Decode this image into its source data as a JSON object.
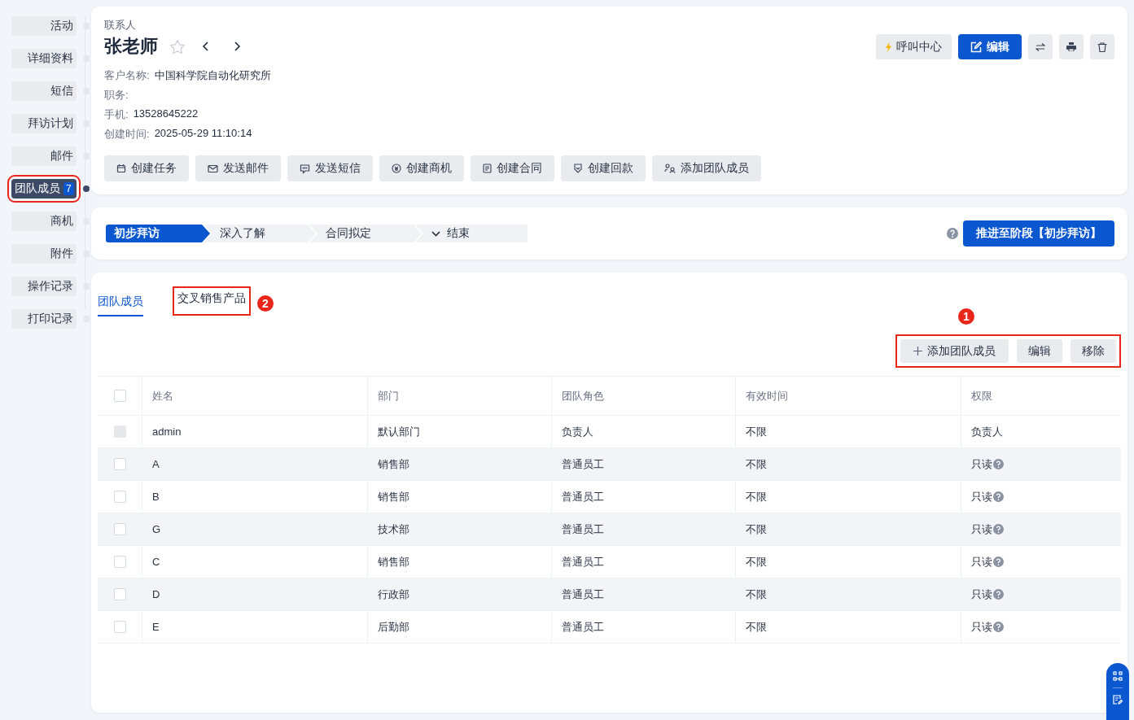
{
  "sidebar": {
    "items": [
      {
        "label": "活动",
        "selected": false
      },
      {
        "label": "详细资料",
        "selected": false
      },
      {
        "label": "短信",
        "selected": false
      },
      {
        "label": "拜访计划",
        "selected": false
      },
      {
        "label": "邮件",
        "selected": false
      },
      {
        "label": "团队成员",
        "count": "7",
        "selected": true,
        "highlighted": true
      },
      {
        "label": "商机",
        "selected": false
      },
      {
        "label": "附件",
        "selected": false
      },
      {
        "label": "操作记录",
        "selected": false
      },
      {
        "label": "打印记录",
        "selected": false
      }
    ]
  },
  "contact": {
    "type_label": "联系人",
    "name": "张老师",
    "starred": false,
    "fields": [
      {
        "label": "客户名称:",
        "value": "中国科学院自动化研究所"
      },
      {
        "label": "职务:"
      },
      {
        "label": "手机:",
        "value": "13528645222"
      },
      {
        "label": "创建时间:",
        "value": "2025-05-29 11:10:14"
      }
    ],
    "call_button": "呼叫中心",
    "edit_button": "编辑",
    "actions": [
      "创建任务",
      "发送邮件",
      "发送短信",
      "创建商机",
      "创建合同",
      "创建回款",
      "添加团队成员"
    ]
  },
  "stages": {
    "items": [
      {
        "label": "初步拜访",
        "selected": true
      },
      {
        "label": "深入了解",
        "selected": false
      },
      {
        "label": "合同拟定",
        "selected": false
      },
      {
        "label": "结束",
        "selected": false,
        "kind": "dropdown"
      }
    ],
    "advance_button": "推进至阶段【初步拜访】"
  },
  "tabs": [
    {
      "label": "团队成员",
      "selected": true,
      "highlighted": false
    },
    {
      "label": "交叉销售产品",
      "selected": false,
      "highlighted": true,
      "marker": "2"
    }
  ],
  "toolbar": {
    "highlighted": true,
    "marker": "1",
    "buttons": [
      {
        "label": "添加团队成员",
        "kind": "add"
      },
      {
        "label": "编辑",
        "kind": "plain"
      },
      {
        "label": "移除",
        "kind": "plain"
      }
    ]
  },
  "table": {
    "select_all_checked": false,
    "columns": [
      "姓名",
      "部门",
      "团队角色",
      "有效时间",
      "权限"
    ],
    "rows": [
      {
        "cells": [
          "admin",
          "默认部门",
          "负责人",
          "不限",
          "负责人"
        ],
        "checked": false,
        "disabled": true,
        "help": false
      },
      {
        "cells": [
          "A",
          "销售部",
          "普通员工",
          "不限",
          "只读"
        ],
        "checked": false,
        "disabled": false,
        "help": true
      },
      {
        "cells": [
          "B",
          "销售部",
          "普通员工",
          "不限",
          "只读"
        ],
        "checked": false,
        "disabled": false,
        "help": true
      },
      {
        "cells": [
          "G",
          "技术部",
          "普通员工",
          "不限",
          "只读"
        ],
        "checked": false,
        "disabled": false,
        "help": true
      },
      {
        "cells": [
          "C",
          "销售部",
          "普通员工",
          "不限",
          "只读"
        ],
        "checked": false,
        "disabled": false,
        "help": true
      },
      {
        "cells": [
          "D",
          "行政部",
          "普通员工",
          "不限",
          "只读"
        ],
        "checked": false,
        "disabled": false,
        "help": true
      },
      {
        "cells": [
          "E",
          "后勤部",
          "普通员工",
          "不限",
          "只读"
        ],
        "checked": false,
        "disabled": false,
        "help": true
      }
    ]
  }
}
